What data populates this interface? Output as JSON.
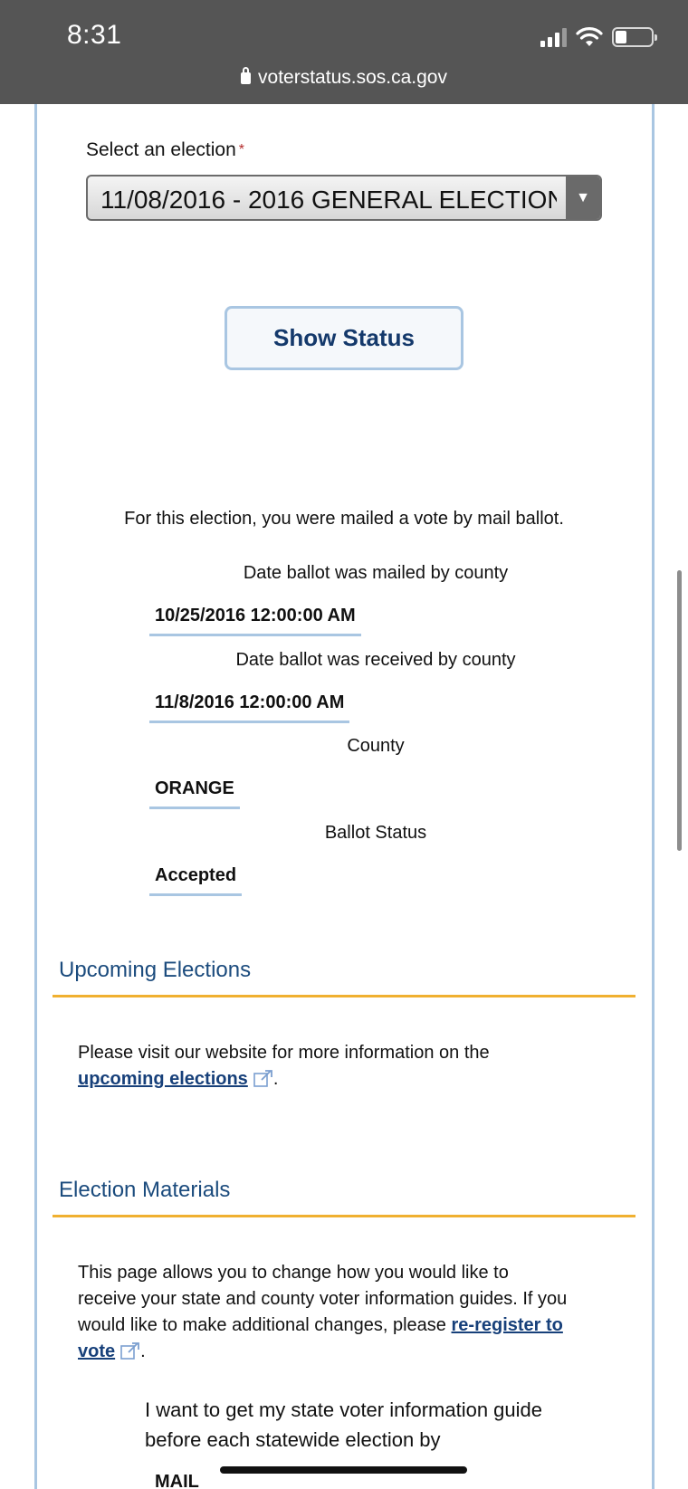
{
  "status_bar": {
    "time": "8:31",
    "url": "voterstatus.sos.ca.gov"
  },
  "election_select": {
    "label": "Select an election",
    "required_mark": "*",
    "value": "11/08/2016 - 2016 GENERAL ELECTION"
  },
  "show_status_button": "Show Status",
  "ballot": {
    "message": "For this election, you were mailed a vote by mail ballot.",
    "fields": [
      {
        "label": "Date ballot was mailed by county",
        "value": "10/25/2016 12:00:00 AM"
      },
      {
        "label": "Date ballot was received by county",
        "value": "11/8/2016 12:00:00 AM"
      },
      {
        "label": "County",
        "value": "ORANGE"
      },
      {
        "label": "Ballot Status",
        "value": "Accepted"
      }
    ]
  },
  "upcoming": {
    "title": "Upcoming Elections",
    "text_before": "Please visit our website for more information on the",
    "link": "upcoming elections",
    "text_after": "."
  },
  "materials": {
    "title": "Election Materials",
    "text": "This page allows you to change how you would like to receive your state and county voter information guides. If you would like to make additional changes, please",
    "link": "re-register to vote",
    "text_after": ".",
    "guide_prompt": "I want to get my state voter information guide before each statewide election by",
    "guide_value": "MAIL"
  },
  "icons": {
    "lock": "lock-icon",
    "external_link": "external-link-icon",
    "dropdown": "triangle-down-icon"
  }
}
